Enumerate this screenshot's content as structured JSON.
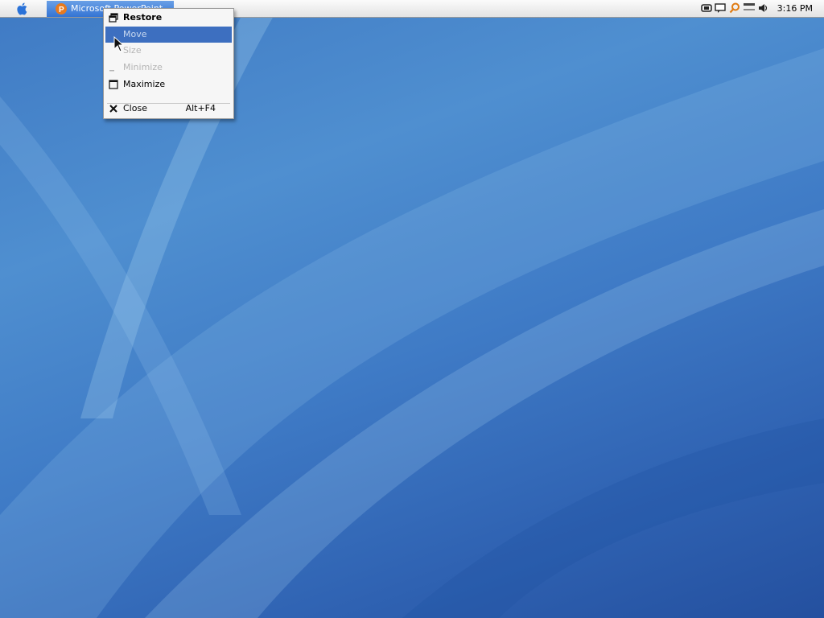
{
  "taskbar": {
    "window_title": "Microsoft PowerPoint"
  },
  "clock": "3:16 PM",
  "window_menu": {
    "items": [
      {
        "label": "Restore",
        "icon": "restore-icon",
        "state": "bold"
      },
      {
        "label": "Move",
        "icon": "",
        "state": "highlighted"
      },
      {
        "label": "Size",
        "icon": "",
        "state": "disabled"
      },
      {
        "label": "Minimize",
        "icon": "minimize-icon",
        "state": "disabled"
      },
      {
        "label": "Maximize",
        "icon": "maximize-icon",
        "state": "normal"
      },
      {
        "label": "Close",
        "shortcut": "Alt+F4",
        "icon": "close-icon",
        "state": "normal"
      }
    ]
  },
  "colors": {
    "desktop": "#3f7ac4",
    "menu_highlight": "#3d6fc0",
    "task_button": "#3474d4"
  }
}
